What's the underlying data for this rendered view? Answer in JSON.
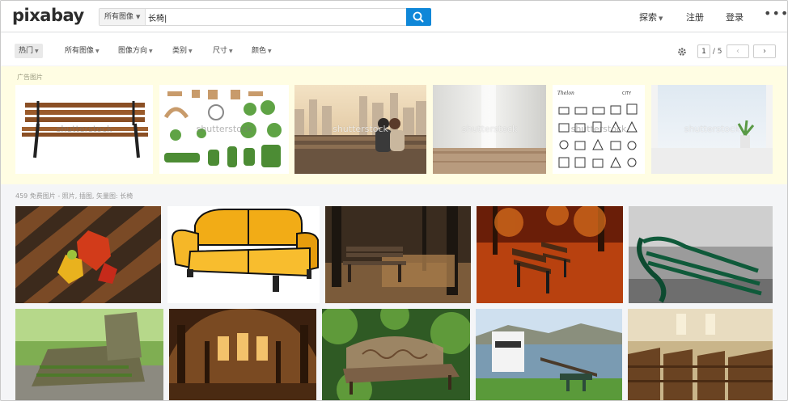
{
  "header": {
    "logo": "pixabay",
    "search_scope": "所有图像",
    "search_value": "长椅|",
    "nav": {
      "explore": "探索",
      "register": "注册",
      "login": "登录",
      "more": "•••"
    }
  },
  "filters": {
    "chips": [
      "热门",
      "所有图像",
      "图像方向",
      "类别",
      "尺寸",
      "颜色"
    ],
    "page_current": "1",
    "page_total": "/ 5",
    "prev": "‹",
    "next": "›"
  },
  "ads": {
    "label": "广告图片",
    "watermark": "shutterstock",
    "tiles": [
      "wooden-bench",
      "landscape-plan",
      "couple-bench-city",
      "wood-table-blur",
      "city-icons",
      "window-sill"
    ]
  },
  "results": {
    "count_text": "459 免费图片 - 照片, 插图, 矢量图: 长椅",
    "images": [
      "autumn-leaves-bench",
      "yellow-sofa",
      "forest-bench",
      "autumn-park-benches",
      "green-bench-bw",
      "mossy-bench",
      "cathedral-interior",
      "ornate-bench",
      "lake-boat-picnic",
      "church-pews"
    ]
  },
  "colors": {
    "search_button": "#0f87d8",
    "ad_background": "#fffde3",
    "active_chip": "#e9e9e9"
  }
}
